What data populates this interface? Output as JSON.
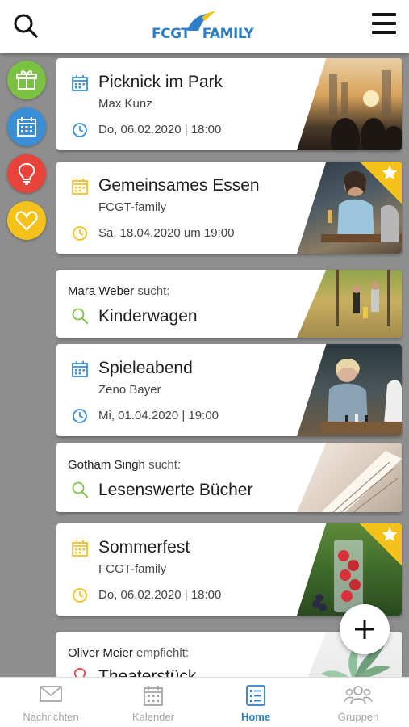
{
  "header": {
    "logo_text_a": "FCGT",
    "logo_text_b": "FAMILY"
  },
  "rail": [
    {
      "name": "gift",
      "color": "#7cc242"
    },
    {
      "name": "calendar",
      "color": "#3a8ed6"
    },
    {
      "name": "lightbulb",
      "color": "#e8433b"
    },
    {
      "name": "heart",
      "color": "#f4c21b"
    }
  ],
  "cards": [
    {
      "title": "Picknick im Park",
      "author": "Max Kunz",
      "date": "Do, 06.02.2020 | 18:00",
      "icon_color": "#3a8ed6",
      "featured": false
    },
    {
      "title": "Gemeinsames Essen",
      "author": "FCGT-family",
      "date": "Sa, 18.04.2020 um 19:00",
      "icon_color": "#f4c21b",
      "featured": true
    },
    {
      "title": "Spieleabend",
      "author": "Zeno Bayer",
      "date": "Mi, 01.04.2020 | 19:00",
      "icon_color": "#3a8ed6",
      "featured": false
    },
    {
      "title": "Sommerfest",
      "author": "FCGT-family",
      "date": "Do, 06.02.2020 | 18:00",
      "icon_color": "#f4c21b",
      "featured": true
    }
  ],
  "requests": [
    {
      "person": "Mara Weber",
      "verb": "sucht:",
      "title": "Kinderwagen"
    },
    {
      "person": "Gotham Singh",
      "verb": "sucht:",
      "title": "Lesenswerte Bücher"
    },
    {
      "person": "Oliver Meier",
      "verb": "empfiehlt:",
      "title": "Theaterstück"
    }
  ],
  "nav": [
    {
      "label": "Nachrichten",
      "icon": "mail-icon",
      "active": false
    },
    {
      "label": "Kalender",
      "icon": "calendar-icon",
      "active": false
    },
    {
      "label": "Home",
      "icon": "home-list-icon",
      "active": true
    },
    {
      "label": "Gruppen",
      "icon": "groups-icon",
      "active": false
    }
  ],
  "colors": {
    "accent": "#2f7fc8",
    "green": "#7cc242",
    "yellow": "#f4c21b",
    "red": "#e8433b"
  }
}
